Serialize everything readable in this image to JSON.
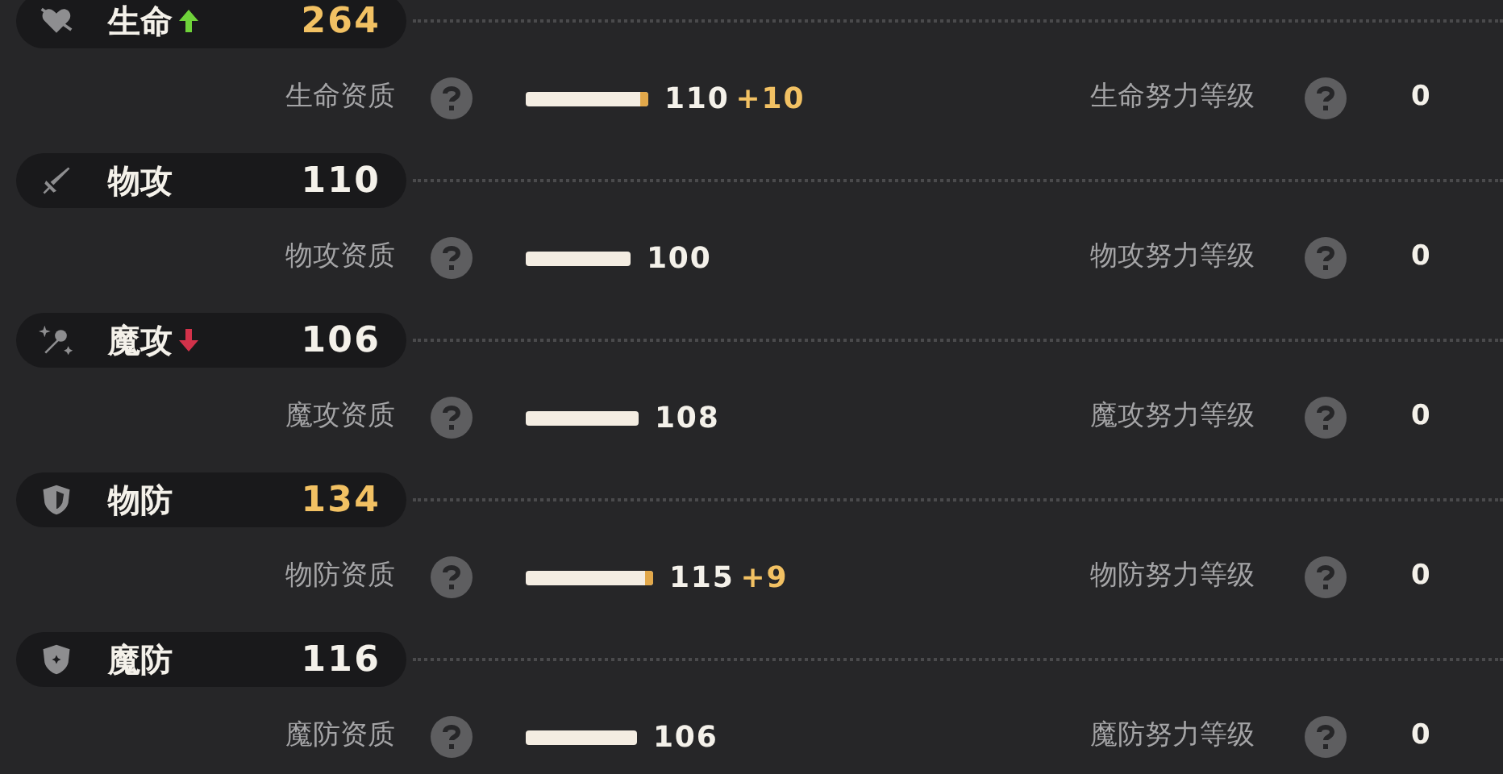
{
  "stats": [
    {
      "kind": "heart",
      "name": "生命",
      "increased": true,
      "decreased": false,
      "value": "264",
      "highlighted": true,
      "aptitude_label": "生命资质",
      "aptitude_value": "110",
      "aptitude_bonus": "+10",
      "effort_label": "生命努力等级",
      "effort_value": "0"
    },
    {
      "kind": "sword",
      "name": "物攻",
      "increased": false,
      "decreased": false,
      "value": "110",
      "highlighted": false,
      "aptitude_label": "物攻资质",
      "aptitude_value": "100",
      "effort_label": "物攻努力等级",
      "effort_value": "0"
    },
    {
      "kind": "wand",
      "name": "魔攻",
      "increased": false,
      "decreased": true,
      "value": "106",
      "highlighted": false,
      "aptitude_label": "魔攻资质",
      "aptitude_value": "108",
      "effort_label": "魔攻努力等级",
      "effort_value": "0"
    },
    {
      "kind": "shield",
      "name": "物防",
      "increased": false,
      "decreased": false,
      "value": "134",
      "highlighted": true,
      "aptitude_label": "物防资质",
      "aptitude_value": "115",
      "aptitude_bonus": "+9",
      "effort_label": "物防努力等级",
      "effort_value": "0"
    },
    {
      "kind": "magic-shield",
      "name": "魔防",
      "increased": false,
      "decreased": false,
      "value": "116",
      "highlighted": false,
      "aptitude_label": "魔防资质",
      "aptitude_value": "106",
      "effort_label": "魔防努力等级",
      "effort_value": "0"
    }
  ]
}
